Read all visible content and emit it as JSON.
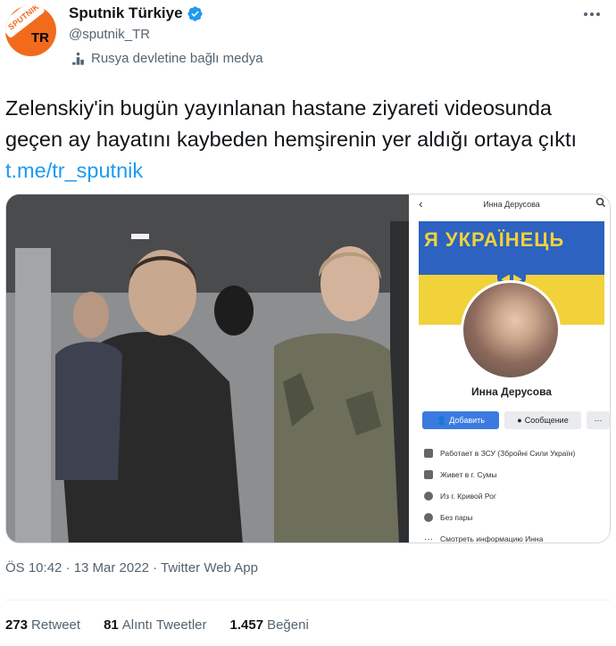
{
  "author": {
    "display_name": "Sputnik Türkiye",
    "handle": "@sputnik_TR",
    "label": "Rusya devletine bağlı medya",
    "avatar": {
      "logo_word": "SPUTNIK",
      "logo_tr": "TR",
      "color": "#f26b1d"
    },
    "verified_color": "#1d9bf0"
  },
  "tweet": {
    "text": "Zelenskiy'in bugün yayınlanan hastane ziyareti videosunda geçen ay hayatını kaybeden hemşirenin yer aldığı ortaya çıktı ",
    "link": "t.me/tr_sputnik"
  },
  "media": {
    "profile_card": {
      "title": "Инна Дерусова",
      "name": "Инна Дерусова",
      "add_label": "Добавить",
      "message_label": "Сообщение",
      "more_label": "···",
      "cover_text": "Я УКРАЇНЕЦЬ",
      "info": [
        {
          "icon": "briefcase-icon",
          "text": "Работает в ЗСУ (Збройні Сили Україн)"
        },
        {
          "icon": "home-icon",
          "text": "Живет в г. Сумы"
        },
        {
          "icon": "location-icon",
          "text": "Из г. Кривой Рог"
        },
        {
          "icon": "heart-icon",
          "text": "Без пары"
        },
        {
          "icon": "more-dots-icon",
          "text": "Смотреть информацию Инна"
        }
      ]
    }
  },
  "meta": {
    "timestamp": "ÖS 10:42 · 13 Mar 2022 · Twitter Web App"
  },
  "stats": {
    "retweets_count": "273",
    "retweets_label": "Retweet",
    "quotes_count": "81",
    "quotes_label": "Alıntı Tweetler",
    "likes_count": "1.457",
    "likes_label": "Beğeni"
  },
  "colors": {
    "text_primary": "#0f1419",
    "text_secondary": "#536471",
    "link": "#1d9bf0",
    "border": "#cfd9de"
  }
}
